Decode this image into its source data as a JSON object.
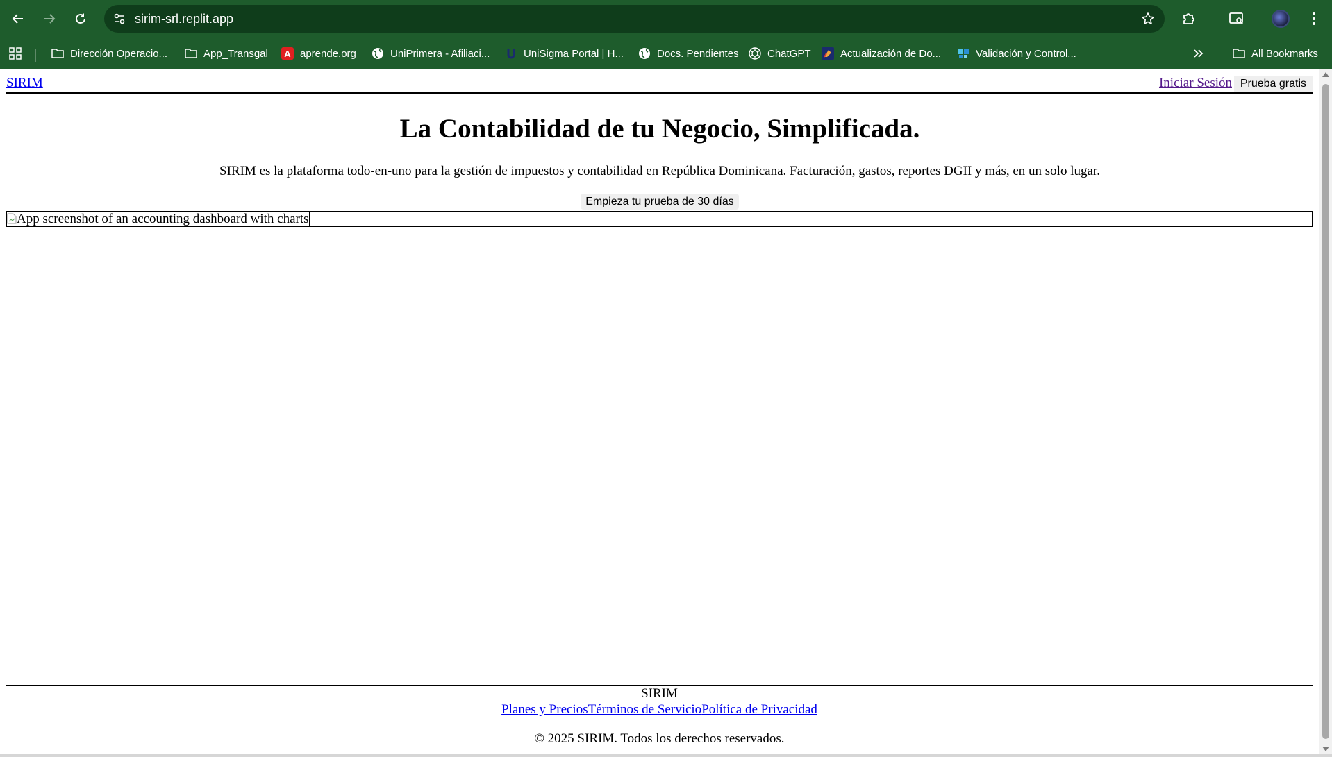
{
  "browser": {
    "url": "sirim-srl.replit.app",
    "bookmarks": [
      {
        "label": "Dirección Operacio...",
        "icon": "folder-icon"
      },
      {
        "label": "App_Transgal",
        "icon": "folder-icon"
      },
      {
        "label": "aprende.org",
        "icon": "aprende-logo-icon"
      },
      {
        "label": "UniPrimera - Afiliaci...",
        "icon": "globe-icon"
      },
      {
        "label": "UniSigma Portal | H...",
        "icon": "unisigma-logo-icon"
      },
      {
        "label": "Docs. Pendientes",
        "icon": "globe-icon"
      },
      {
        "label": "ChatGPT",
        "icon": "chatgpt-icon"
      },
      {
        "label": "Actualización de Do...",
        "icon": "doc-app-icon"
      },
      {
        "label": "Validación y Control...",
        "icon": "validation-app-icon"
      }
    ],
    "all_bookmarks_label": "All Bookmarks",
    "theme_color": "#1e5c2c"
  },
  "header": {
    "logo": "SIRIM",
    "login": "Iniciar Sesión",
    "trial": "Prueba gratis"
  },
  "hero": {
    "title": "La Contabilidad de tu Negocio, Simplificada.",
    "subtitle": "SIRIM es la plataforma todo-en-uno para la gestión de impuestos y contabilidad en República Dominicana. Facturación, gastos, reportes DGII y más, en un solo lugar.",
    "cta": "Empieza tu prueba de 30 días",
    "image_alt": "App screenshot of an accounting dashboard with charts"
  },
  "footer": {
    "brand": "SIRIM",
    "links": [
      "Planes y Precios",
      "Términos de Servicio",
      "Política de Privacidad"
    ],
    "copyright": "© 2025 SIRIM. Todos los derechos reservados."
  }
}
